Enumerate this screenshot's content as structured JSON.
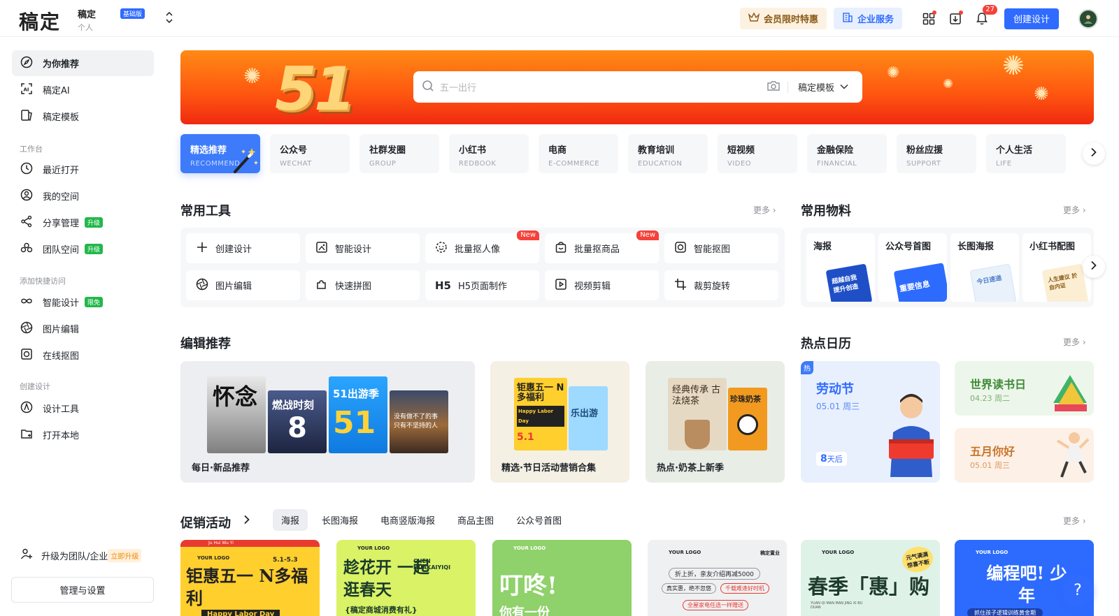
{
  "header": {
    "logo": "稿定",
    "workspace_name": "稿定",
    "workspace_type": "个人",
    "plan_badge": "基础版",
    "vip_label": "会员限时特惠",
    "enterprise_label": "企业服务",
    "notification_count": "27",
    "create_label": "创建设计"
  },
  "sidebar": {
    "items": [
      {
        "label": "为你推荐"
      },
      {
        "label": "稿定AI"
      },
      {
        "label": "稿定模板"
      }
    ],
    "group_workbench": "工作台",
    "workbench": [
      {
        "label": "最近打开"
      },
      {
        "label": "我的空间"
      },
      {
        "label": "分享管理",
        "tag": "升级"
      },
      {
        "label": "团队空间",
        "tag": "升级"
      }
    ],
    "group_quick": "添加快捷访问",
    "quick": [
      {
        "label": "智能设计",
        "tag": "限免"
      },
      {
        "label": "图片编辑"
      },
      {
        "label": "在线抠图"
      }
    ],
    "group_create": "创建设计",
    "create": [
      {
        "label": "设计工具"
      },
      {
        "label": "打开本地"
      }
    ],
    "upgrade_label": "升级为团队/企业",
    "upgrade_tag": "立即升级",
    "manage_label": "管理与设置"
  },
  "banner": {
    "number": "51",
    "search_placeholder": "五一出行",
    "search_scope": "稿定模板"
  },
  "categories": [
    {
      "cn": "精选推荐",
      "en": "RECOMMEND"
    },
    {
      "cn": "公众号",
      "en": "WECHAT"
    },
    {
      "cn": "社群发圈",
      "en": "GROUP"
    },
    {
      "cn": "小红书",
      "en": "REDBOOK"
    },
    {
      "cn": "电商",
      "en": "E-COMMERCE"
    },
    {
      "cn": "教育培训",
      "en": "EDUCATION"
    },
    {
      "cn": "短视频",
      "en": "VIDEO"
    },
    {
      "cn": "金融保险",
      "en": "FINANCIAL"
    },
    {
      "cn": "粉丝应援",
      "en": "SUPPORT"
    },
    {
      "cn": "个人生活",
      "en": "LIFE"
    }
  ],
  "tools_section": {
    "title": "常用工具",
    "more": "更多",
    "items": [
      {
        "label": "创建设计"
      },
      {
        "label": "智能设计"
      },
      {
        "label": "批量抠人像",
        "tag": "New"
      },
      {
        "label": "批量抠商品",
        "tag": "New"
      },
      {
        "label": "智能抠图"
      },
      {
        "label": "图片编辑"
      },
      {
        "label": "快速拼图"
      },
      {
        "label": "H5页面制作"
      },
      {
        "label": "视频剪辑"
      },
      {
        "label": "裁剪旋转"
      }
    ]
  },
  "materials_section": {
    "title": "常用物料",
    "more": "更多",
    "items": [
      {
        "label": "海报",
        "thumb_text": "超越自我 提升创造"
      },
      {
        "label": "公众号首图",
        "thumb_text": "重要信息"
      },
      {
        "label": "长图海报",
        "thumb_text": "今日速递"
      },
      {
        "label": "小红书配图",
        "thumb_text": "人生建议 於自内证"
      }
    ]
  },
  "editor_section": {
    "title": "编辑推荐",
    "cards": [
      {
        "label": "每日·新品推荐",
        "poster1": "怀念",
        "poster2": "燃战时刻",
        "poster2_num": "8",
        "poster3_title": "51出游季",
        "poster3_num": "51",
        "poster4": "没有做不了的事 只有不坚持的人"
      },
      {
        "label": "精选·节日活动营销合集",
        "poster1_title": "钜惠五一 N多福利",
        "poster1_sub": "Happy Labor Day",
        "poster1_price": "5.1",
        "poster2": "乐出游"
      },
      {
        "label": "热点·奶茶上新季",
        "poster1": "经典传承 古法烧茶",
        "poster2": "珍珠奶茶"
      }
    ]
  },
  "calendar_section": {
    "title": "热点日历",
    "more": "更多",
    "main": {
      "hot": "热",
      "title": "劳动节",
      "date": "05.01 周三",
      "countdown_num": "8",
      "countdown_unit": "天后"
    },
    "side": [
      {
        "title": "世界读书日",
        "date": "04.23 周二"
      },
      {
        "title": "五月你好",
        "date": "05.01 周三"
      }
    ]
  },
  "promo_section": {
    "title": "促销活动",
    "more": "更多",
    "tabs": [
      "海报",
      "长图海报",
      "电商竖版海报",
      "商品主图",
      "公众号首图"
    ],
    "cards": [
      {
        "logo": "YOUR LOGO",
        "big": "钜惠五一 N多福利",
        "sub": "Happy Labor Day",
        "top": "Ju Hui Wu Yi",
        "date": "5.1-5.3"
      },
      {
        "logo": "YOUR LOGO",
        "big": "趁花开 一起逛春天",
        "sub": "{稿定商城消费有礼}",
        "en": "CHEN HUAKAIYIQI"
      },
      {
        "logo": "YOUR LOGO",
        "big": "叮咚!",
        "sub": "你有一份"
      },
      {
        "logo": "YOUR LOGO",
        "corner": "稿定置业",
        "l1": "折上折，亲友介绍再减5000",
        "l2a": "真实惠，绝不忽悠",
        "l2b": "千载难逢好时机",
        "l3": "全屋家电任选一样赠送"
      },
      {
        "logo": "YOUR LOGO",
        "big": "春季「惠」购",
        "stamp": "元气满满 惊喜不断",
        "sub": "YUAN QI MAN MAN JING XI BU DUAN"
      },
      {
        "logo": "YOUR LOGO",
        "big": "编程吧! 少年",
        "sub": "抓住孩子逻辑训练黄金期"
      }
    ]
  },
  "help_label": "?",
  "colors": {
    "accent": "#2f6bff",
    "banner": "#ff5a10",
    "green_tag": "#22b84a",
    "red_badge": "#f5413a"
  }
}
